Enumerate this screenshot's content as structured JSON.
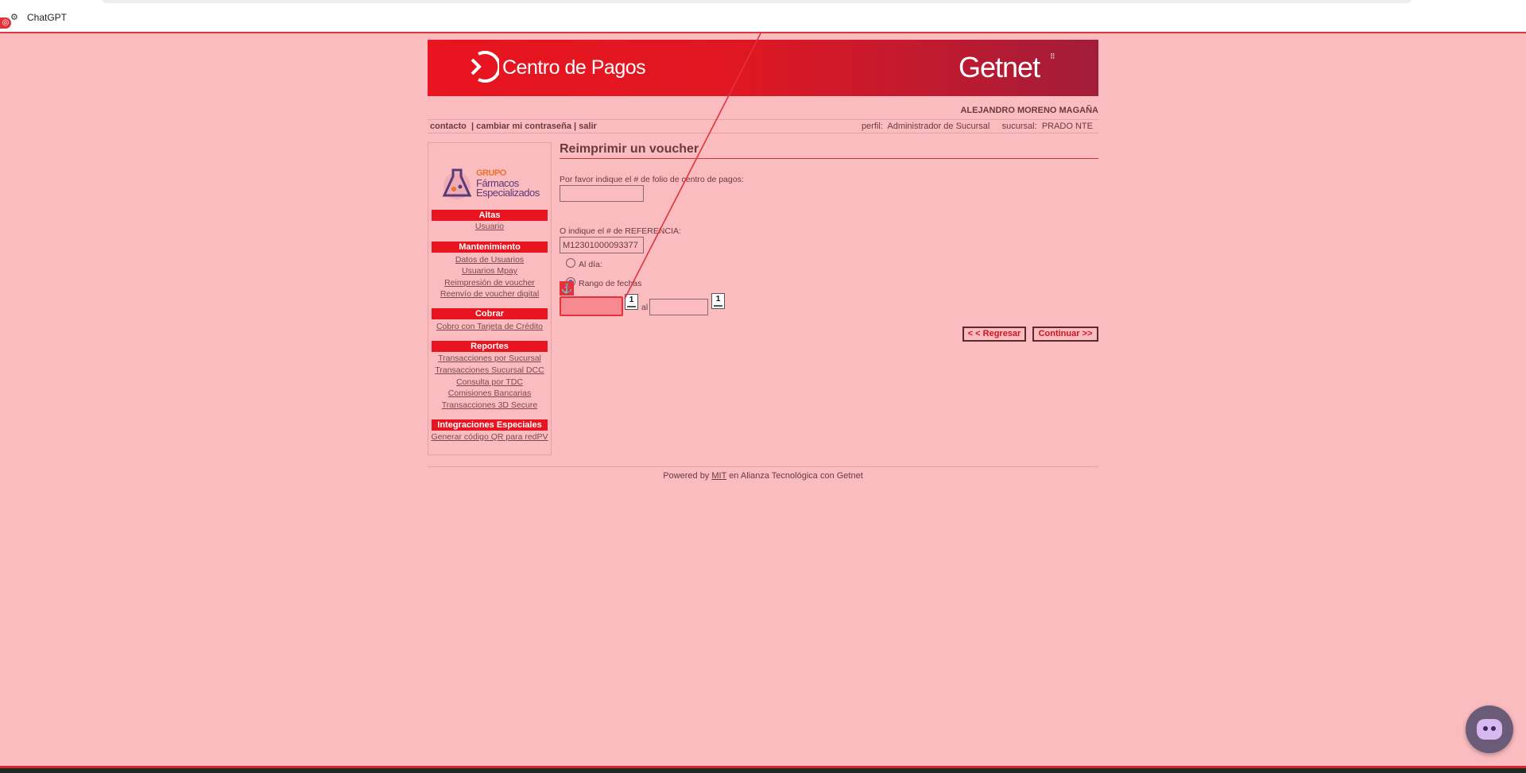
{
  "browser": {
    "tab_title": "ChatGPT",
    "tab_icon": "openai-icon"
  },
  "banner": {
    "brand": "Centro de Pagos",
    "partner": "Getnet"
  },
  "user": {
    "name": "ALEJANDRO MORENO MAGAÑA",
    "links": {
      "contacto": "contacto",
      "sep1": "|",
      "cambiar": "cambiar mi contraseña",
      "sep2": "|",
      "salir": "salir"
    },
    "profile_label": "perfil:",
    "profile_value": "Administrador de Sucursal",
    "branch_label": "sucursal:",
    "branch_value": "PRADO NTE"
  },
  "sidebar": {
    "logo": {
      "line1": "GRUPO",
      "line2": "Fármacos",
      "line3": "Especializados"
    },
    "sections": [
      {
        "title": "Altas",
        "items": [
          "Usuario"
        ]
      },
      {
        "title": "Mantenimiento",
        "items": [
          "Datos de Usuarios",
          "Usuarios Mpay",
          "Reimpresión de voucher",
          "Reenvío de voucher digital"
        ]
      },
      {
        "title": "Cobrar",
        "items": [
          "Cobro con Tarjeta de Crédito"
        ]
      },
      {
        "title": "Reportes",
        "items": [
          "Transacciones por Sucursal",
          "Transacciones Sucursal DCC",
          "Consulta por TDC",
          "Comisiones Bancarias",
          "Transacciones 3D Secure"
        ]
      },
      {
        "title": "Integraciones Especiales",
        "items": [
          "Generar código QR para redPV"
        ]
      }
    ]
  },
  "main": {
    "title": "Reimprimir un voucher",
    "folio_label": "Por favor indique el # de folio de centro de pagos:",
    "folio_value": "",
    "ref_label": "O indique el # de REFERENCIA:",
    "ref_value": "M12301000093377",
    "radio_today": "Al día:",
    "radio_range": "Rango de fechas",
    "range_selected": true,
    "date_from": "",
    "date_sep": "al",
    "date_to": "",
    "calendar_glyph": "1",
    "btn_back": "< < Regresar",
    "btn_continue": "Continuar >>"
  },
  "footer": {
    "prefix": "Powered by",
    "mit": "MIT",
    "suffix": "en Alianza Tecnológica con Getnet"
  },
  "colors": {
    "accent": "#e8141f",
    "overlay_bg": "#fbbcc0",
    "highlight": "#e2323c"
  }
}
